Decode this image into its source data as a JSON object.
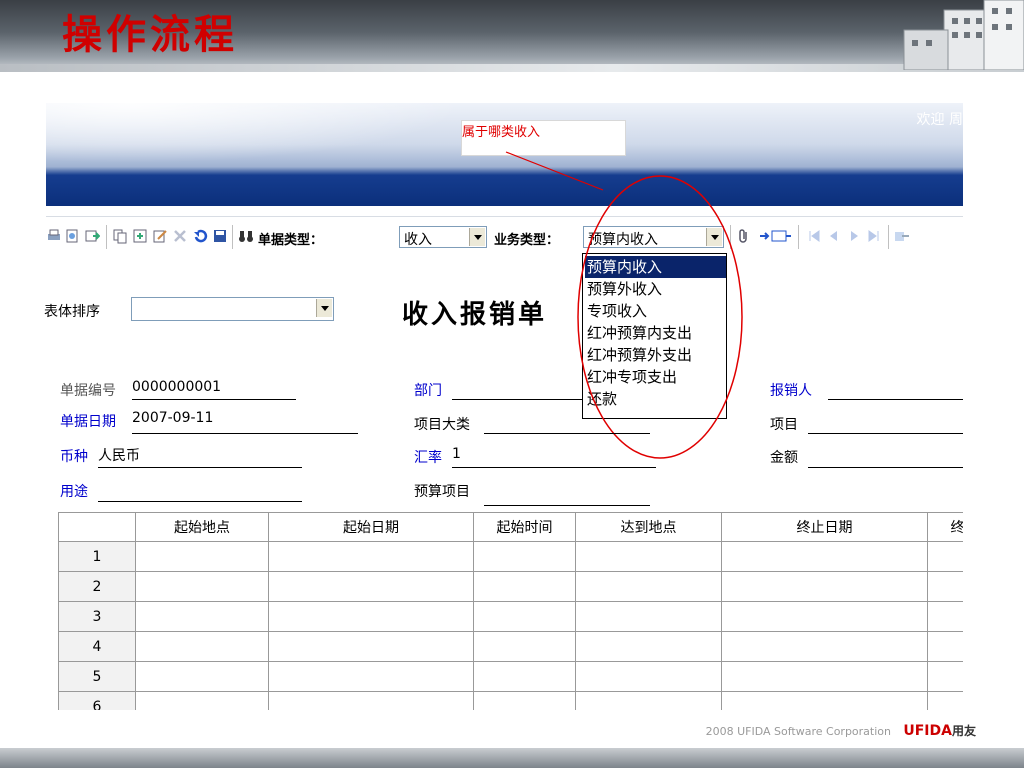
{
  "slide": {
    "title": "操作流程",
    "footer_text": "2008 UFIDA Software Corporation",
    "footer_logo": "UFIDA",
    "footer_logo_cn": "用友"
  },
  "banner": {
    "welcome": "欢迎 周",
    "callout": "属于哪类收入"
  },
  "toolbar": {
    "doc_type_label": "单据类型：",
    "doc_type_value": "收入",
    "biz_type_label": "业务类型：",
    "biz_type_value": "预算内收入"
  },
  "dropdown": {
    "options": [
      "预算内收入",
      "预算外收入",
      "专项收入",
      "红冲预算内支出",
      "红冲预算外支出",
      "红冲专项支出",
      "还款"
    ]
  },
  "form": {
    "sort_label": "表体排序",
    "title": "收入报销单",
    "fields": {
      "doc_no_label": "单据编号",
      "doc_no": "0000000001",
      "dept_label": "部门",
      "reporter_label": "报销人",
      "date_label": "单据日期",
      "date": "2007-09-11",
      "project_cat_label": "项目大类",
      "project_label": "项目",
      "currency_label": "币种",
      "currency": "人民币",
      "rate_label": "汇率",
      "rate": "1",
      "amount_label": "金额",
      "purpose_label": "用途",
      "budget_item_label": "预算项目"
    }
  },
  "grid": {
    "headers": [
      "",
      "起始地点",
      "起始日期",
      "起始时间",
      "达到地点",
      "终止日期",
      "终"
    ],
    "rows": [
      "1",
      "2",
      "3",
      "4",
      "5",
      "6"
    ]
  },
  "colors": {
    "title_red": "#d00000",
    "banner_blue": "#0b2f7b",
    "selection_blue": "#0a246a",
    "callout_red": "#e00000"
  }
}
